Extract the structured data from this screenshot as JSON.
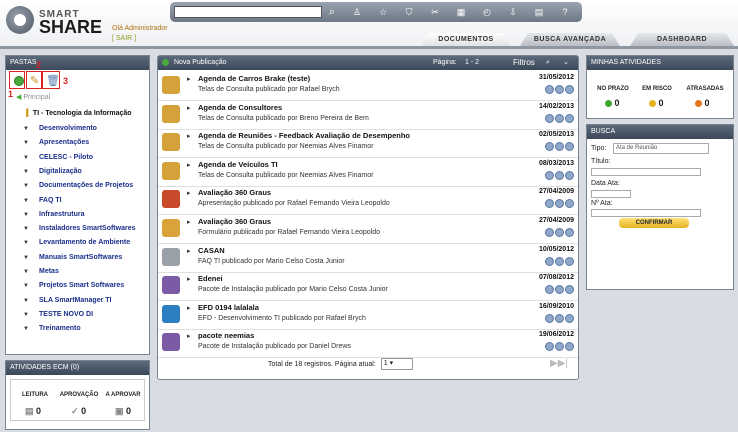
{
  "app": {
    "brand_line1": "SMART",
    "brand_line2": "SHARE",
    "greeting": "Olá Administrador",
    "logout": "[ SAIR ]"
  },
  "tabs": [
    {
      "label": "DOCUMENTOS"
    },
    {
      "label": "BUSCA AVANÇADA"
    },
    {
      "label": "DASHBOARD"
    }
  ],
  "pastas": {
    "title": "PASTAS",
    "annotations": [
      "1",
      "2",
      "3"
    ],
    "root": "Principal",
    "root_child": "TI - Tecnologia da Informação",
    "items": [
      "Desenvolvimento",
      "Apresentações",
      "CELESC - Piloto",
      "Digitalização",
      "Documentações de Projetos",
      "FAQ TI",
      "Infraestrutura",
      "Instaladores SmartSoftwares",
      "Levantamento de Ambiente",
      "Manuais SmartSoftwares",
      "Metas",
      "Projetos Smart Softwares",
      "SLA SmartManager TI",
      "TESTE NOVO DI",
      "Treinamento"
    ]
  },
  "atividades_ecm": {
    "title": "ATIVIDADES ECM (0)",
    "cols": [
      {
        "label": "LEITURA",
        "count": "0"
      },
      {
        "label": "APROVAÇÃO",
        "count": "0"
      },
      {
        "label": "A APROVAR",
        "count": "0"
      }
    ]
  },
  "main": {
    "new_pub": "Nova Publicação",
    "page_label": "Página:",
    "page_range": "1 - 2",
    "filters": "Filtros",
    "items": [
      {
        "title": "Agenda de Carros Brake (teste)",
        "sub": "Telas de Consulta publicado por Rafael Brych",
        "date": "31/05/2012"
      },
      {
        "title": "Agenda de Consultores",
        "sub": "Telas de Consulta publicado por Breno Pereira de Bem",
        "date": "14/02/2013"
      },
      {
        "title": "Agenda de Reuniões - Feedback Avaliação de Desempenho",
        "sub": "Telas de Consulta publicado por Neemias Alves Finamor",
        "date": "02/05/2013"
      },
      {
        "title": "Agenda de Veículos TI",
        "sub": "Telas de Consulta publicado por Neemias Alves Finamor",
        "date": "08/03/2013"
      },
      {
        "title": "Avaliação 360 Graus",
        "sub": "Apresentação publicado por Rafael Fernando Vieira Leopoldo",
        "date": "27/04/2009"
      },
      {
        "title": "Avaliação 360 Graus",
        "sub": "Formulário publicado por Rafael Fernando Vieira Leopoldo",
        "date": "27/04/2009"
      },
      {
        "title": "CASAN",
        "sub": "FAQ TI publicado por Mario Celso Costa Junior",
        "date": "10/05/2012"
      },
      {
        "title": "Edenei",
        "sub": "Pacote de Instalação publicado por Mario Celso Costa Junior",
        "date": "07/08/2012"
      },
      {
        "title": "EFD 0194 lalalala",
        "sub": "EFD - Desenvolvimento TI publicado por Rafael Brych",
        "date": "16/09/2010"
      },
      {
        "title": "pacote neemias",
        "sub": "Pacote de Instalação publicado por Daniel Drews",
        "date": "19/06/2012"
      }
    ],
    "footer": "Total de 18 registros. Página atual:",
    "page_select": "1"
  },
  "minhas": {
    "title": "MINHAS ATIVIDADES",
    "cols": [
      {
        "label": "NO PRAZO",
        "count": "0",
        "color": "#3fa52c"
      },
      {
        "label": "EM RISCO",
        "count": "0",
        "color": "#e3b21c"
      },
      {
        "label": "ATRASADAS",
        "count": "0",
        "color": "#e2751c"
      }
    ]
  },
  "busca": {
    "title": "BUSCA",
    "tipo_label": "Tipo:",
    "tipo_value": "Ata de Reunião",
    "titulo_label": "Título:",
    "data_label": "Data Ata:",
    "num_label": "Nº Ata:",
    "button": "CONFIRMAR"
  }
}
